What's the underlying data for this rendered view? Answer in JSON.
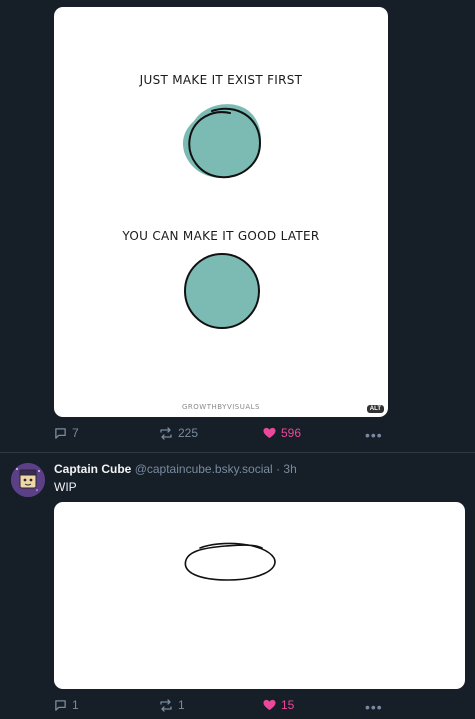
{
  "post1": {
    "image": {
      "heading_top": "JUST MAKE IT EXIST FIRST",
      "heading_bottom": "YOU CAN MAKE IT GOOD LATER",
      "footer": "GROWTHBYVISUALS",
      "alt_badge": "ALT",
      "circle_color": "#7bbbb3"
    },
    "actions": {
      "reply_count": "7",
      "repost_count": "225",
      "like_count": "596"
    }
  },
  "post2": {
    "author_name": "Captain Cube",
    "author_handle": "@captaincube.bsky.social",
    "separator": "·",
    "time": "3h",
    "text": "WIP",
    "actions": {
      "reply_count": "1",
      "repost_count": "1",
      "like_count": "15"
    }
  },
  "colors": {
    "background": "#161e27",
    "muted_text": "#788ba0",
    "like_accent": "#ec4899",
    "divider": "#2e3945"
  },
  "icons": {
    "reply": "speech-bubble-icon",
    "repost": "repost-arrows-icon",
    "like": "heart-icon",
    "more": "more-horizontal-icon"
  }
}
